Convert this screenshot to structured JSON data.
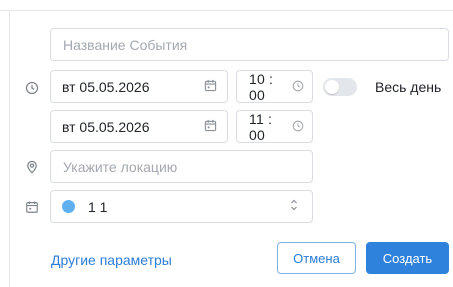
{
  "event_form": {
    "title_placeholder": "Название События",
    "start": {
      "date": "вт 05.05.2026",
      "time": "10 : 00"
    },
    "end": {
      "date": "вт 05.05.2026",
      "time": "11 : 00"
    },
    "all_day": {
      "label": "Весь день",
      "enabled": false
    },
    "location_placeholder": "Укажите локацию",
    "calendar": {
      "name": "1 1",
      "color": "#5eb0ef"
    },
    "more_params_link": "Другие параметры",
    "cancel_label": "Отмена",
    "create_label": "Создать"
  },
  "colors": {
    "accent": "#2f82dc",
    "link": "#2b7dd8",
    "placeholder": "#a3a9b1",
    "border": "#d9dde3"
  },
  "icons": [
    "clock-icon",
    "calendar-icon",
    "location-pin-icon",
    "calendar-list-icon",
    "chevron-updown-icon"
  ]
}
